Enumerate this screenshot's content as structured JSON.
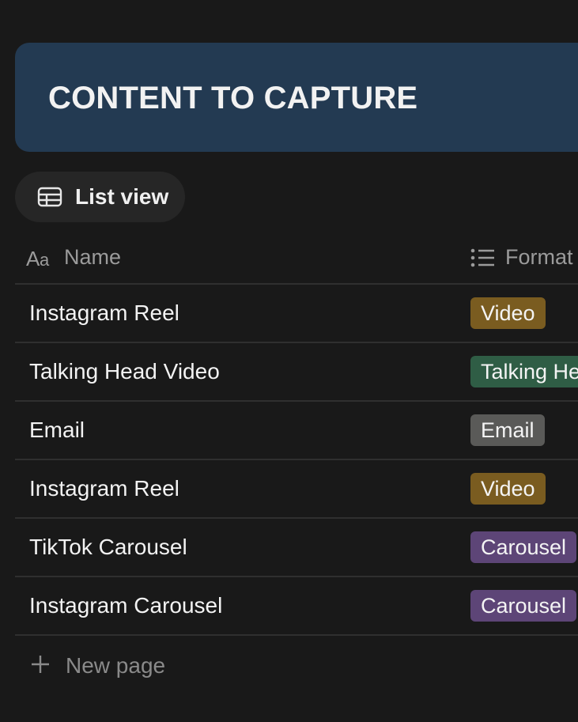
{
  "banner": {
    "title": "CONTENT TO CAPTURE",
    "color": "#233a52"
  },
  "view_tab": {
    "label": "List view",
    "icon": "table-icon"
  },
  "columns": [
    {
      "label": "Name",
      "icon": "text-property-icon"
    },
    {
      "label": "Format",
      "icon": "multi-select-list-icon"
    }
  ],
  "rows": [
    {
      "name": "Instagram Reel",
      "format": "Video",
      "tag_color": "#7a5c20"
    },
    {
      "name": "Talking Head Video",
      "format": "Talking Head",
      "tag_color": "#2f5d45"
    },
    {
      "name": "Email",
      "format": "Email",
      "tag_color": "#5a5a58"
    },
    {
      "name": "Instagram Reel",
      "format": "Video",
      "tag_color": "#7a5c20"
    },
    {
      "name": "TikTok Carousel",
      "format": "Carousel",
      "tag_color": "#5d4577"
    },
    {
      "name": "Instagram Carousel",
      "format": "Carousel",
      "tag_color": "#5d4577"
    }
  ],
  "new_page": {
    "label": "New page",
    "icon": "plus-icon"
  }
}
